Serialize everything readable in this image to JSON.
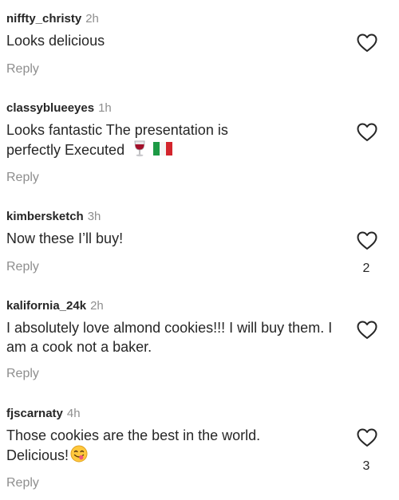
{
  "comments": [
    {
      "username": "niffty_christy",
      "time": "2h",
      "text": "Looks delicious",
      "reply_label": "Reply",
      "likes": ""
    },
    {
      "username": "classyblueeyes",
      "time": "1h",
      "text_line1": "Looks fantastic The presentation is",
      "text_line2": "perfectly Executed",
      "emojis": [
        "wine-glass-emoji",
        "italy-flag-emoji"
      ],
      "reply_label": "Reply",
      "likes": ""
    },
    {
      "username": "kimbersketch",
      "time": "3h",
      "text": "Now these I’ll buy!",
      "reply_label": "Reply",
      "likes": "2"
    },
    {
      "username": "kalifornia_24k",
      "time": "2h",
      "text": "I absolutely love almond cookies!!! I will buy them. I am a cook not a baker.",
      "reply_label": "Reply",
      "likes": ""
    },
    {
      "username": "fjscarnaty",
      "time": "4h",
      "text_line1": "Those cookies are the best in the world.",
      "text_line2": "Delicious!",
      "emojis": [
        "yum-face-emoji"
      ],
      "reply_label": "Reply",
      "likes": "3"
    }
  ],
  "icons": {
    "like": "heart-outline-icon"
  },
  "colors": {
    "text": "#262626",
    "secondary": "#8e8e8e"
  }
}
